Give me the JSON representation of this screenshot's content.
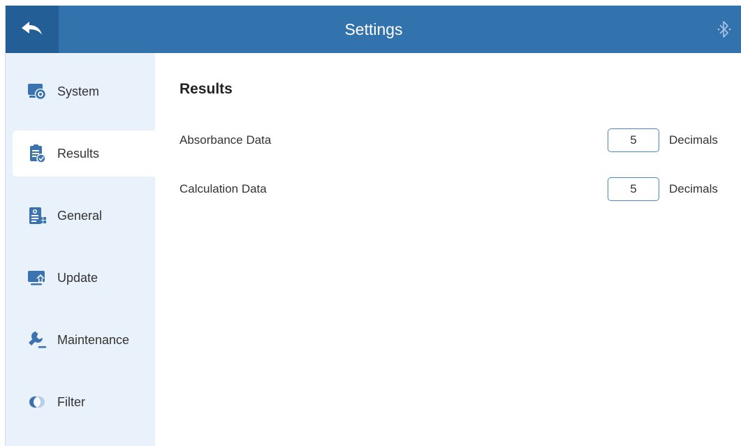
{
  "header": {
    "title": "Settings",
    "back_icon": "back-arrow-icon",
    "bluetooth_icon": "bluetooth-icon"
  },
  "sidebar": {
    "items": [
      {
        "label": "System",
        "icon": "system-icon"
      },
      {
        "label": "Results",
        "icon": "results-clipboard-icon",
        "active": true
      },
      {
        "label": "General",
        "icon": "general-document-icon"
      },
      {
        "label": "Update",
        "icon": "update-monitor-icon"
      },
      {
        "label": "Maintenance",
        "icon": "wrench-icon"
      },
      {
        "label": "Filter",
        "icon": "filter-icon"
      }
    ]
  },
  "main": {
    "section_title": "Results",
    "rows": [
      {
        "label": "Absorbance Data",
        "value": "5",
        "unit": "Decimals"
      },
      {
        "label": "Calculation Data",
        "value": "5",
        "unit": "Decimals"
      }
    ]
  },
  "colors": {
    "header": "#3373ad",
    "back_button": "#235f96",
    "sidebar": "#e9f1fb",
    "accent": "#4d86c4"
  }
}
